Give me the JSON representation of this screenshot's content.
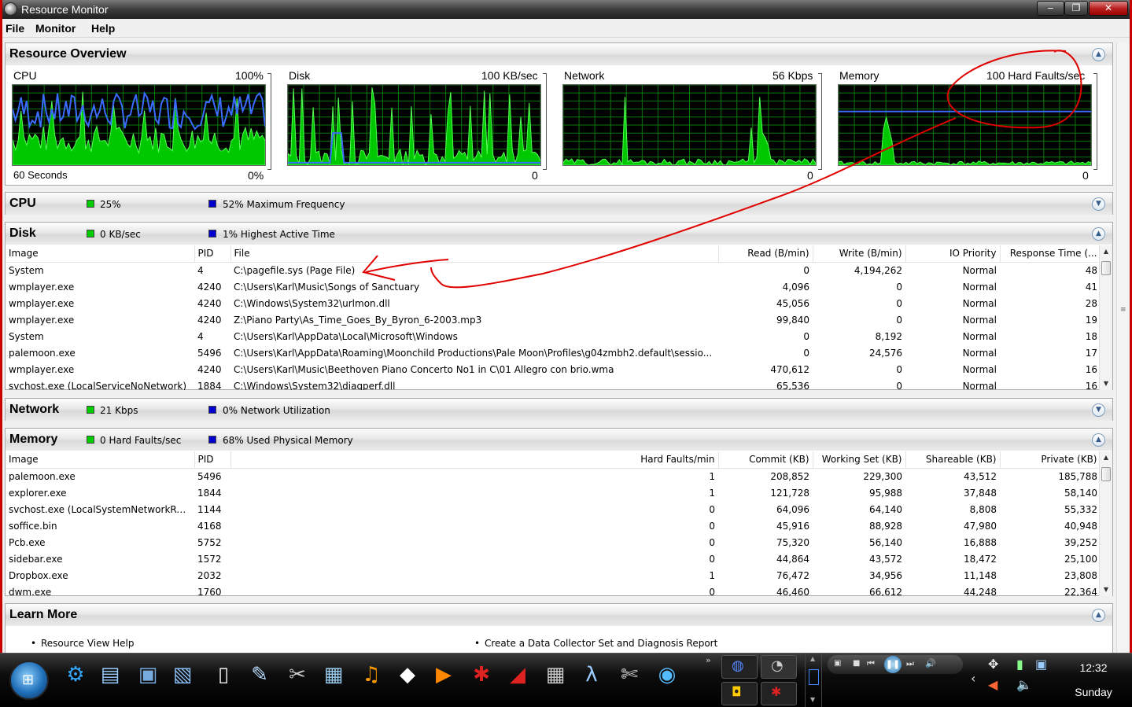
{
  "window": {
    "title": "Resource Monitor",
    "menu": [
      "File",
      "Monitor",
      "Help"
    ],
    "buttons": {
      "minimize": "‒",
      "restore": "❐",
      "close": "✕"
    }
  },
  "overview": {
    "title": "Resource Overview",
    "graphs": [
      {
        "name": "CPU",
        "max": "100%",
        "bottom_left": "60 Seconds",
        "min": "0%"
      },
      {
        "name": "Disk",
        "max": "100 KB/sec",
        "bottom_left": "",
        "min": "0"
      },
      {
        "name": "Network",
        "max": "56 Kbps",
        "bottom_left": "",
        "min": "0"
      },
      {
        "name": "Memory",
        "max": "100 Hard Faults/sec",
        "bottom_left": "",
        "min": "0"
      }
    ]
  },
  "cpu": {
    "title": "CPU",
    "stat1": "25%",
    "stat2": "52% Maximum Frequency"
  },
  "disk": {
    "title": "Disk",
    "stat1": "0 KB/sec",
    "stat2": "1% Highest Active Time",
    "columns": [
      "Image",
      "PID",
      "File",
      "Read (B/min)",
      "Write (B/min)",
      "IO Priority",
      "Response Time (..."
    ],
    "rows": [
      [
        "System",
        "4",
        "C:\\pagefile.sys (Page File)",
        "0",
        "4,194,262",
        "Normal",
        "48"
      ],
      [
        "wmplayer.exe",
        "4240",
        "C:\\Users\\Karl\\Music\\Songs of Sanctuary",
        "4,096",
        "0",
        "Normal",
        "41"
      ],
      [
        "wmplayer.exe",
        "4240",
        "C:\\Windows\\System32\\urlmon.dll",
        "45,056",
        "0",
        "Normal",
        "28"
      ],
      [
        "wmplayer.exe",
        "4240",
        "Z:\\Piano Party\\As_Time_Goes_By_Byron_6-2003.mp3",
        "99,840",
        "0",
        "Normal",
        "19"
      ],
      [
        "System",
        "4",
        "C:\\Users\\Karl\\AppData\\Local\\Microsoft\\Windows",
        "0",
        "8,192",
        "Normal",
        "18"
      ],
      [
        "palemoon.exe",
        "5496",
        "C:\\Users\\Karl\\AppData\\Roaming\\Moonchild Productions\\Pale Moon\\Profiles\\g04zmbh2.default\\sessio...",
        "0",
        "24,576",
        "Normal",
        "17"
      ],
      [
        "wmplayer.exe",
        "4240",
        "C:\\Users\\Karl\\Music\\Beethoven Piano Concerto No1 in C\\01 Allegro con brio.wma",
        "470,612",
        "0",
        "Normal",
        "16"
      ],
      [
        "svchost.exe (LocalServiceNoNetwork)",
        "1884",
        "C:\\Windows\\System32\\diagperf.dll",
        "65,536",
        "0",
        "Normal",
        "16"
      ]
    ]
  },
  "network": {
    "title": "Network",
    "stat1": "21 Kbps",
    "stat2": "0% Network Utilization"
  },
  "memory": {
    "title": "Memory",
    "stat1": "0 Hard Faults/sec",
    "stat2": "68% Used Physical Memory",
    "columns": [
      "Image",
      "PID",
      "Hard Faults/min",
      "Commit (KB)",
      "Working Set (KB)",
      "Shareable (KB)",
      "Private (KB)"
    ],
    "rows": [
      [
        "palemoon.exe",
        "5496",
        "1",
        "208,852",
        "229,300",
        "43,512",
        "185,788"
      ],
      [
        "explorer.exe",
        "1844",
        "1",
        "121,728",
        "95,988",
        "37,848",
        "58,140"
      ],
      [
        "svchost.exe (LocalSystemNetworkRest...",
        "1144",
        "0",
        "64,096",
        "64,140",
        "8,808",
        "55,332"
      ],
      [
        "soffice.bin",
        "4168",
        "0",
        "45,916",
        "88,928",
        "47,980",
        "40,948"
      ],
      [
        "Pcb.exe",
        "5752",
        "0",
        "75,320",
        "56,140",
        "16,888",
        "39,252"
      ],
      [
        "sidebar.exe",
        "1572",
        "0",
        "44,864",
        "43,572",
        "18,472",
        "25,100"
      ],
      [
        "Dropbox.exe",
        "2032",
        "1",
        "76,472",
        "34,956",
        "11,148",
        "23,808"
      ],
      [
        "dwm.exe",
        "1760",
        "0",
        "46,460",
        "66,612",
        "44,248",
        "22,364"
      ]
    ]
  },
  "learn": {
    "title": "Learn More",
    "link1": "Resource View Help",
    "link2": "Create a Data Collector Set and Diagnosis Report"
  },
  "taskbar": {
    "time": "12:32",
    "day": "Sunday"
  },
  "colors": {
    "graph_green": "#00c800",
    "graph_blue": "#3a6cff",
    "grid": "#0a7a0a",
    "annotation": "#e00000",
    "frame": "#c80000"
  }
}
